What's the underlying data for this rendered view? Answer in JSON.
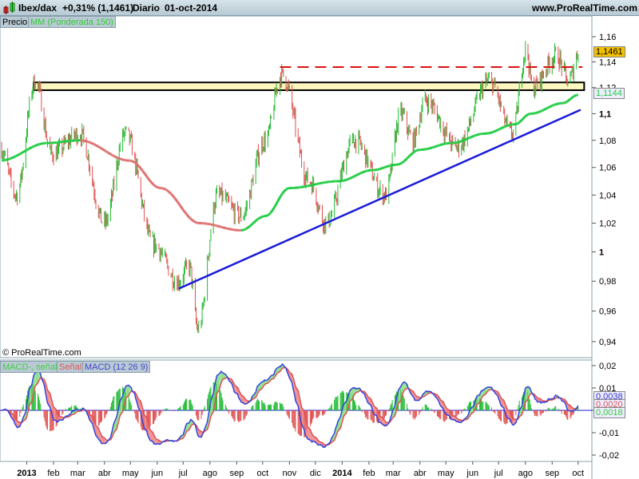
{
  "header": {
    "symbol": "Ibex/dax",
    "change": "+0,31% (1,1461)",
    "period": "Diario",
    "date": "01-oct-2014",
    "site": "www.ProRealTime.com"
  },
  "legend": {
    "price": "Precio",
    "ma": "MM (Ponderada 150)",
    "copyright": "© ProRealTime.com",
    "macd_hist": "MACD-, señal",
    "signal": "Señal",
    "macd": "MACD (12 26 9)"
  },
  "colors": {
    "up": "#22bb33",
    "down": "#e05050",
    "ma": "#22cc44",
    "trend": "#1a1add",
    "resist": "#dd1111",
    "box": "#fff7c0"
  },
  "chart_data": {
    "type": "line",
    "title": "Ibex/dax Diario",
    "price_axis": {
      "scale": "log",
      "ticks": [
        "1,16",
        "1,14",
        "1,12",
        "1,1",
        "1,08",
        "1,06",
        "1,04",
        "1,02",
        "1",
        "0,98",
        "0,96",
        "0,94"
      ],
      "tick_values": [
        1.16,
        1.14,
        1.12,
        1.1,
        1.08,
        1.06,
        1.04,
        1.02,
        1,
        0.98,
        0.96,
        0.94
      ]
    },
    "macd_axis": {
      "ticks": [
        "0,02",
        "0,01",
        "0",
        "-0,01",
        "-0,02"
      ],
      "tick_values": [
        0.02,
        0.01,
        0,
        -0.01,
        -0.02
      ]
    },
    "x_ticks": [
      {
        "date": "2013-01-01",
        "label": "2013",
        "bold": true
      },
      {
        "date": "2013-02-01",
        "label": "feb"
      },
      {
        "date": "2013-03-01",
        "label": "mar"
      },
      {
        "date": "2013-04-01",
        "label": "abr"
      },
      {
        "date": "2013-05-01",
        "label": "may"
      },
      {
        "date": "2013-06-01",
        "label": "jun"
      },
      {
        "date": "2013-07-01",
        "label": "jul"
      },
      {
        "date": "2013-08-01",
        "label": "ago"
      },
      {
        "date": "2013-09-01",
        "label": "sep"
      },
      {
        "date": "2013-10-01",
        "label": "oct"
      },
      {
        "date": "2013-11-01",
        "label": "nov"
      },
      {
        "date": "2013-12-01",
        "label": "dic"
      },
      {
        "date": "2014-01-01",
        "label": "2014",
        "bold": true
      },
      {
        "date": "2014-02-01",
        "label": "feb"
      },
      {
        "date": "2014-03-01",
        "label": "mar"
      },
      {
        "date": "2014-04-01",
        "label": "abr"
      },
      {
        "date": "2014-05-01",
        "label": "may"
      },
      {
        "date": "2014-06-01",
        "label": "jun"
      },
      {
        "date": "2014-07-01",
        "label": "jul"
      },
      {
        "date": "2014-08-01",
        "label": "ago"
      },
      {
        "date": "2014-09-01",
        "label": "sep"
      },
      {
        "date": "2014-10-01",
        "label": "oct"
      }
    ],
    "price_waypoints": [
      [
        "2012-12-01",
        1.075
      ],
      [
        "2012-12-20",
        1.04
      ],
      [
        "2013-01-11",
        1.125
      ],
      [
        "2013-01-30",
        1.07
      ],
      [
        "2013-03-03",
        1.085
      ],
      [
        "2013-04-01",
        1.02
      ],
      [
        "2013-04-25",
        1.085
      ],
      [
        "2013-05-28",
        1.005
      ],
      [
        "2013-06-25",
        0.98
      ],
      [
        "2013-07-08",
        0.99
      ],
      [
        "2013-07-18",
        0.948
      ],
      [
        "2013-08-10",
        1.04
      ],
      [
        "2013-09-06",
        1.025
      ],
      [
        "2013-10-04",
        1.08
      ],
      [
        "2013-10-23",
        1.13
      ],
      [
        "2013-11-24",
        1.05
      ],
      [
        "2013-12-13",
        1.02
      ],
      [
        "2014-01-15",
        1.08
      ],
      [
        "2014-02-20",
        1.04
      ],
      [
        "2014-03-10",
        1.1
      ],
      [
        "2014-03-24",
        1.08
      ],
      [
        "2014-04-07",
        1.11
      ],
      [
        "2014-05-14",
        1.075
      ],
      [
        "2014-06-20",
        1.125
      ],
      [
        "2014-07-17",
        1.085
      ],
      [
        "2014-08-02",
        1.15
      ],
      [
        "2014-08-09",
        1.12
      ],
      [
        "2014-09-06",
        1.145
      ],
      [
        "2014-09-20",
        1.125
      ],
      [
        "2014-10-01",
        1.1461
      ]
    ],
    "ma_waypoints": [
      [
        "2012-12-01",
        1.065
      ],
      [
        "2013-01-25",
        1.078
      ],
      [
        "2013-03-03",
        1.08
      ],
      [
        "2013-04-30",
        1.065
      ],
      [
        "2013-06-05",
        1.045
      ],
      [
        "2013-07-20",
        1.02
      ],
      [
        "2013-09-06",
        1.015
      ],
      [
        "2013-10-04",
        1.025
      ],
      [
        "2013-11-01",
        1.045
      ],
      [
        "2013-12-28",
        1.05
      ],
      [
        "2014-02-05",
        1.058
      ],
      [
        "2014-03-05",
        1.062
      ],
      [
        "2014-04-01",
        1.073
      ],
      [
        "2014-05-08",
        1.078
      ],
      [
        "2014-06-15",
        1.085
      ],
      [
        "2014-07-20",
        1.092
      ],
      [
        "2014-08-07",
        1.1
      ],
      [
        "2014-09-13",
        1.108
      ],
      [
        "2014-10-01",
        1.1144
      ]
    ],
    "trendline": [
      [
        "2013-06-26",
        0.975
      ],
      [
        "2014-10-04",
        1.103
      ]
    ],
    "resistance": {
      "value": 1.136,
      "from": "2013-10-21",
      "to": "2014-10-06"
    },
    "zone": {
      "low": 1.118,
      "high": 1.124,
      "from": "2013-01-09",
      "to": "2014-10-08"
    },
    "last_price": "1,1461",
    "last_ma": "1,1144",
    "macd_last": "0,0038",
    "signal_last": "0,0020",
    "hist_last": "0,0018"
  }
}
